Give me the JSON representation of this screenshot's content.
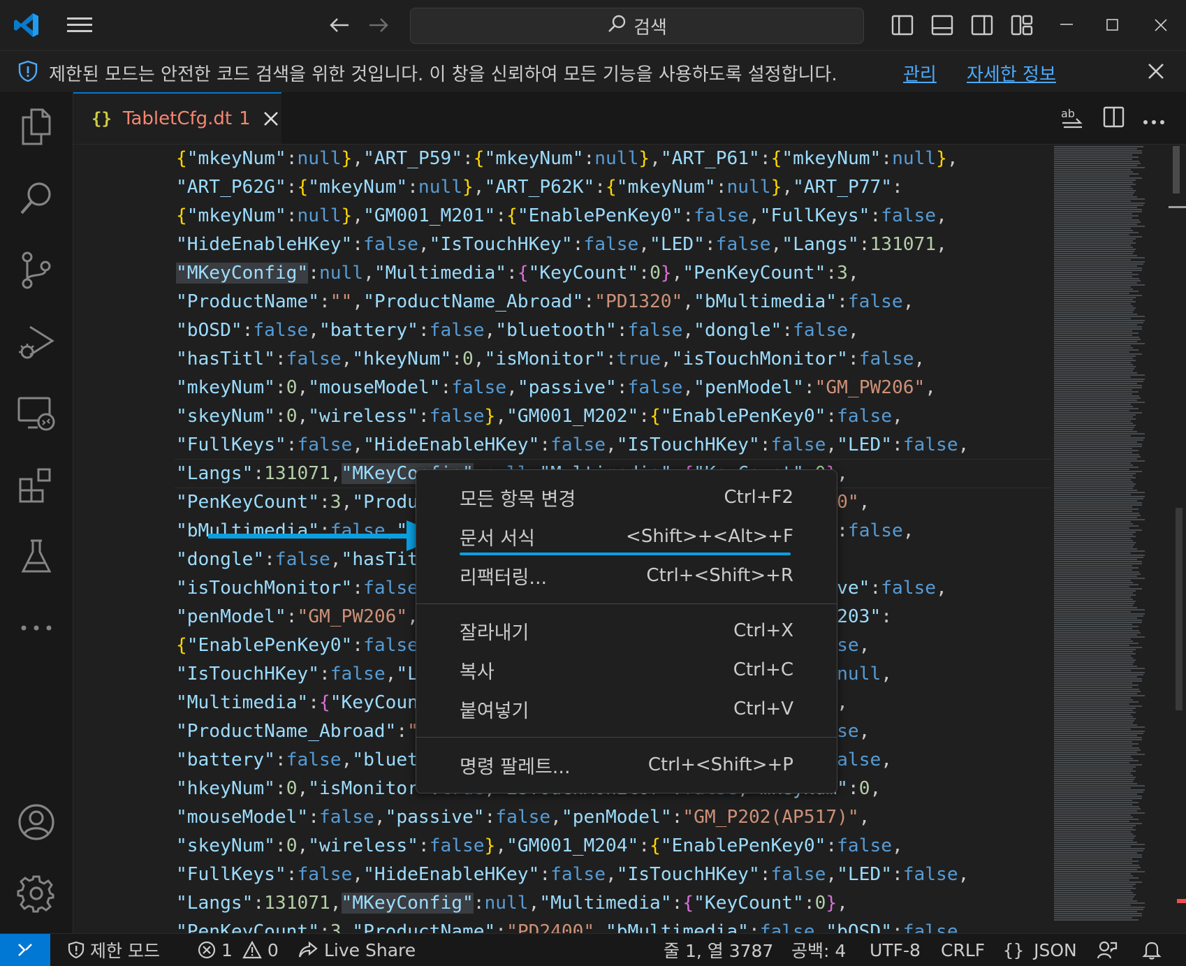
{
  "title_bar": {
    "search_placeholder": "검색",
    "icons": [
      "vscode-logo-icon",
      "menu-icon",
      "back-arrow-icon",
      "forward-arrow-icon",
      "search-icon",
      "toggle-primary-sidebar-icon",
      "toggle-panel-icon",
      "toggle-secondary-sidebar-icon",
      "customize-layout-icon",
      "minimize-icon",
      "maximize-icon",
      "close-icon"
    ]
  },
  "banner": {
    "message": "제한된 모드는 안전한 코드 검색을 위한 것입니다. 이 창을 신뢰하여 모든 기능을 사용하도록 설정합니다.",
    "manage_link": "관리",
    "learn_more_link": "자세한 정보"
  },
  "activity_bar": {
    "items": [
      "explorer-icon",
      "search-icon",
      "source-control-icon",
      "run-debug-icon",
      "remote-explorer-icon",
      "extensions-icon",
      "testing-icon",
      "more-icon"
    ],
    "bottom": [
      "accounts-icon",
      "manage-gear-icon"
    ]
  },
  "tab": {
    "icon": "{}",
    "name": "TabletCfg.dt",
    "problems": "1"
  },
  "editor_lines": [
    "{\"mkeyNum\":null},\"ART_P59\":{\"mkeyNum\":null},\"ART_P61\":{\"mkeyNum\":null},",
    "\"ART_P62G\":{\"mkeyNum\":null},\"ART_P62K\":{\"mkeyNum\":null},\"ART_P77\":",
    "{\"mkeyNum\":null},\"GM001_M201\":{\"EnablePenKey0\":false,\"FullKeys\":false,",
    "\"HideEnableHKey\":false,\"IsTouchHKey\":false,\"LED\":false,\"Langs\":131071,",
    "\"MKeyConfig\":null,\"Multimedia\":{\"KeyCount\":0},\"PenKeyCount\":3,",
    "\"ProductName\":\"\",\"ProductName_Abroad\":\"PD1320\",\"bMultimedia\":false,",
    "\"bOSD\":false,\"battery\":false,\"bluetooth\":false,\"dongle\":false,",
    "\"hasTitl\":false,\"hkeyNum\":0,\"isMonitor\":true,\"isTouchMonitor\":false,",
    "\"mkeyNum\":0,\"mouseModel\":false,\"passive\":false,\"penModel\":\"GM_PW206\",",
    "\"skeyNum\":0,\"wireless\":false},\"GM001_M202\":{\"EnablePenKey0\":false,",
    "\"FullKeys\":false,\"HideEnableHKey\":false,\"IsTouchHKey\":false,\"LED\":false,",
    "\"Langs\":131071,\"MKeyConfig\":null,\"Multimedia\":{\"KeyCount\":0},",
    "\"PenKeyCount\":3,\"ProductName\":\"\",\"ProductName_Abroad\":\"PD1220\",",
    "\"bMultimedia\":false,\"bOSD\":false,\"battery\":false,\"bluetooth\":false,",
    "\"dongle\":false,\"hasTitl\":false,\"hkeyNum\":0,\"isMonitor\":true,",
    "\"isTouchMonitor\":false,\"mkeyNum\":0,\"mouseModel\":false,\"passive\":false,",
    "\"penModel\":\"GM_PW206\",\"skeyNum\":0,\"wireless\":false},\"GM001_M203\":",
    "{\"EnablePenKey0\":false,\"FullKeys\":false,\"HideEnableHKey\":false,",
    "\"IsTouchHKey\":false,\"LED\":false,\"Langs\":131071,\"MKeyConfig\":null,",
    "\"Multimedia\":{\"KeyCount\":0},\"PenKeyCount\":3,\"ProductName\":\"\",",
    "\"ProductName_Abroad\":\"PD1320\",\"bMultimedia\":false,\"bOSD\":false,",
    "\"battery\":false,\"bluetooth\":false,\"dongle\":false,\"hasTitl\":false,",
    "\"hkeyNum\":0,\"isMonitor\":true,\"isTouchMonitor\":false,\"mkeyNum\":0,",
    "\"mouseModel\":false,\"passive\":false,\"penModel\":\"GM_P202(AP517)\",",
    "\"skeyNum\":0,\"wireless\":false},\"GM001_M204\":{\"EnablePenKey0\":false,",
    "\"FullKeys\":false,\"HideEnableHKey\":false,\"IsTouchHKey\":false,\"LED\":false,",
    "\"Langs\":131071,\"MKeyConfig\":null,\"Multimedia\":{\"KeyCount\":0},",
    "\"PenKeyCount\":3,\"ProductName\":\"PD2400\",\"bMultimedia\":false,\"bOSD\":false,"
  ],
  "context_menu": {
    "items": [
      {
        "label": "모든 항목 변경",
        "shortcut": "Ctrl+F2"
      },
      {
        "label": "문서 서식",
        "shortcut": "<Shift>+<Alt>+F"
      },
      {
        "label": "리팩터링...",
        "shortcut": "Ctrl+<Shift>+R"
      },
      {
        "label": "잘라내기",
        "shortcut": "Ctrl+X"
      },
      {
        "label": "복사",
        "shortcut": "Ctrl+C"
      },
      {
        "label": "붙여넣기",
        "shortcut": "Ctrl+V"
      },
      {
        "label": "명령 팔레트...",
        "shortcut": "Ctrl+<Shift>+P"
      }
    ]
  },
  "status_bar": {
    "restricted_mode": "제한 모드",
    "errors": "1",
    "warnings": "0",
    "live_share": "Live Share",
    "position": "줄 1, 열 3787",
    "spaces": "공백: 4",
    "encoding": "UTF-8",
    "eol": "CRLF",
    "language": "JSON"
  },
  "colors": {
    "accent": "#0078d4",
    "annotation_arrow": "#0a9fe0",
    "status_remote": "#0078d4"
  }
}
